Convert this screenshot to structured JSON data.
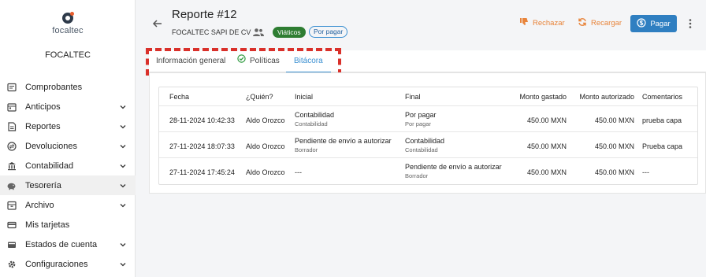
{
  "sidebar": {
    "logo_text": "focaltec",
    "company": "FOCALTEC",
    "items": [
      {
        "label": "Comprobantes",
        "icon": "receipt-icon",
        "expandable": false
      },
      {
        "label": "Anticipos",
        "icon": "calendar-icon",
        "expandable": true
      },
      {
        "label": "Reportes",
        "icon": "report-icon",
        "expandable": true
      },
      {
        "label": "Devoluciones",
        "icon": "exchange-icon",
        "expandable": true
      },
      {
        "label": "Contabilidad",
        "icon": "bank-icon",
        "expandable": true
      },
      {
        "label": "Tesorería",
        "icon": "piggy-bank-icon",
        "expandable": true,
        "active": true
      },
      {
        "label": "Archivo",
        "icon": "archive-icon",
        "expandable": true
      },
      {
        "label": "Mis tarjetas",
        "icon": "credit-card-icon",
        "expandable": false
      },
      {
        "label": "Estados de cuenta",
        "icon": "wallet-icon",
        "expandable": true
      },
      {
        "label": "Configuraciones",
        "icon": "gear-icon",
        "expandable": true
      }
    ]
  },
  "header": {
    "title": "Reporte #12",
    "subtitle": "FOCALTEC SAPI DE CV",
    "badge_type": "Viáticos",
    "badge_status": "Por pagar",
    "reject_label": "Rechazar",
    "reload_label": "Recargar",
    "pay_label": "Pagar"
  },
  "tabs": [
    {
      "label": "Información general"
    },
    {
      "label": "Políticas"
    },
    {
      "label": "Bitácora",
      "active": true
    }
  ],
  "table": {
    "headers": [
      "Fecha",
      "¿Quién?",
      "Inicial",
      "Final",
      "Monto gastado",
      "Monto autorizado",
      "Comentarios"
    ],
    "rows": [
      {
        "fecha": "28-11-2024 10:42:33",
        "quien": "Aldo Orozco",
        "inicial": "Contabilidad",
        "inicial_sub": "Contabilidad",
        "final": "Por pagar",
        "final_sub": "Por pagar",
        "gastado": "450.00 MXN",
        "autorizado": "450.00 MXN",
        "comentarios": "prueba capa"
      },
      {
        "fecha": "27-11-2024 18:07:33",
        "quien": "Aldo Orozco",
        "inicial": "Pendiente de envío a autorizar",
        "inicial_sub": "Borrador",
        "final": "Contabilidad",
        "final_sub": "Contabilidad",
        "gastado": "450.00 MXN",
        "autorizado": "450.00 MXN",
        "comentarios": "Prueba capa"
      },
      {
        "fecha": "27-11-2024 17:45:24",
        "quien": "Aldo Orozco",
        "inicial": "---",
        "inicial_sub": "",
        "final": "Pendiente de envío a autorizar",
        "final_sub": "Borrador",
        "gastado": "450.00 MXN",
        "autorizado": "450.00 MXN",
        "comentarios": "---"
      }
    ]
  },
  "colors": {
    "accent": "#3a8fd1",
    "pay_button": "#2f7fc1",
    "warning_action": "#e8843a",
    "badge_green": "#2e7d32",
    "highlight": "#d9302a"
  }
}
